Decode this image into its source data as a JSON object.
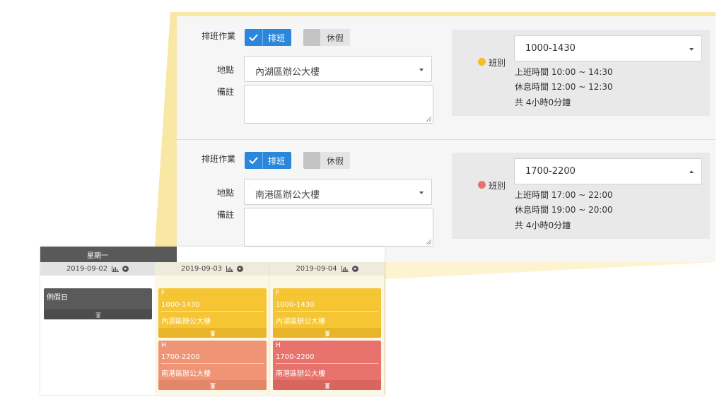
{
  "detail": {
    "entries": [
      {
        "work_label": "排班作業",
        "toggle_on_label": "排班",
        "toggle_off_label": "休假",
        "location_label": "地點",
        "location_value": "內湖區辦公大樓",
        "note_label": "備註",
        "note_value": "",
        "shift_label": "班別",
        "shift_value": "1000-1430",
        "shift_color": "#f5bc23",
        "work_hours": "上班時間 10:00 ~ 14:30",
        "break_hours": "休息時間 12:00 ~ 12:30",
        "total": "共 4小時0分鐘"
      },
      {
        "work_label": "排班作業",
        "toggle_on_label": "排班",
        "toggle_off_label": "休假",
        "location_label": "地點",
        "location_value": "南港區辦公大樓",
        "note_label": "備註",
        "note_value": "",
        "shift_label": "班別",
        "shift_value": "1700-2200",
        "shift_color": "#e8726c",
        "work_hours": "上班時間 17:00 ~ 22:00",
        "break_hours": "休息時間 19:00 ~ 20:00",
        "total": "共 4小時0分鐘"
      }
    ]
  },
  "calendar": {
    "weekday_header": "星期一",
    "columns": [
      {
        "date": "2019-09-02",
        "holiday_label": "例假日"
      },
      {
        "date": "2019-09-03",
        "cards": [
          {
            "code": "F",
            "time": "1000-1430",
            "location": "內湖區辦公大樓"
          },
          {
            "code": "H",
            "time": "1700-2200",
            "location": "南港區辦公大樓"
          }
        ]
      },
      {
        "date": "2019-09-04",
        "cards": [
          {
            "code": "F",
            "time": "1000-1430",
            "location": "內湖區辦公大樓"
          },
          {
            "code": "H",
            "time": "1700-2200",
            "location": "南港區辦公大樓"
          }
        ]
      }
    ]
  },
  "colors": {
    "accent_blue": "#2b87da",
    "card_yellow": "#f6c533",
    "card_orange": "#ef9474",
    "card_red": "#e8726c",
    "holiday_gray": "#5a5a5a"
  },
  "icons": [
    "check-icon",
    "caret-down-icon",
    "caret-up-icon",
    "chart-icon",
    "circle-chevron-icon",
    "trash-icon"
  ]
}
